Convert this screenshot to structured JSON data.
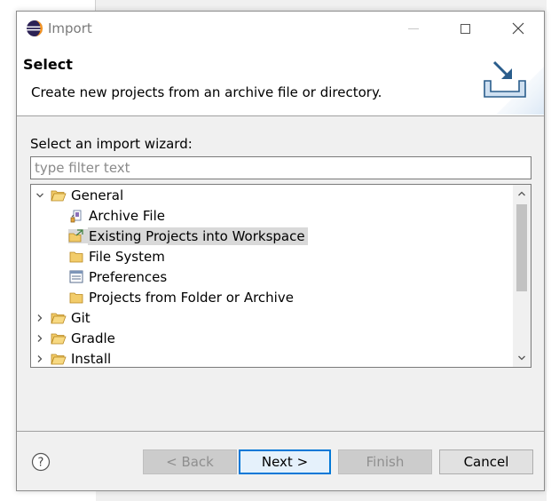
{
  "window": {
    "title": "Import"
  },
  "header": {
    "title": "Select",
    "description": "Create new projects from an archive file or directory."
  },
  "wizard": {
    "label": "Select an import wizard:",
    "filter_placeholder": "type filter text",
    "filter_value": "",
    "tree": [
      {
        "label": "General",
        "level": 0,
        "expanded": true,
        "icon": "folder-open-icon"
      },
      {
        "label": "Archive File",
        "level": 1,
        "icon": "archive-file-icon"
      },
      {
        "label": "Existing Projects into Workspace",
        "level": 1,
        "icon": "existing-projects-icon",
        "selected": true
      },
      {
        "label": "File System",
        "level": 1,
        "icon": "folder-icon"
      },
      {
        "label": "Preferences",
        "level": 1,
        "icon": "preferences-icon"
      },
      {
        "label": "Projects from Folder or Archive",
        "level": 1,
        "icon": "folder-icon"
      },
      {
        "label": "Git",
        "level": 0,
        "expanded": false,
        "icon": "folder-open-icon"
      },
      {
        "label": "Gradle",
        "level": 0,
        "expanded": false,
        "icon": "folder-open-icon"
      },
      {
        "label": "Install",
        "level": 0,
        "expanded": false,
        "icon": "folder-open-icon"
      }
    ]
  },
  "buttons": {
    "back": "< Back",
    "next": "Next >",
    "finish": "Finish",
    "cancel": "Cancel"
  },
  "colors": {
    "accent": "#0078d7",
    "selection": "#d9d9d9",
    "folder": "#e8b84a"
  }
}
